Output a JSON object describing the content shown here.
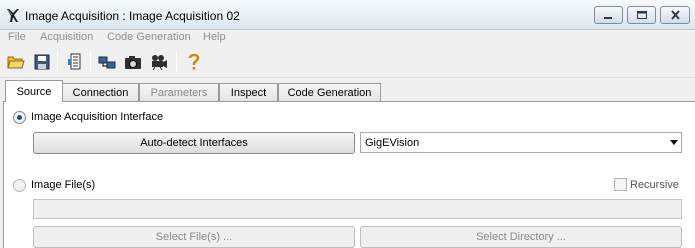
{
  "window": {
    "title": "Image Acquisition : Image Acquisition 02"
  },
  "menu": {
    "items": [
      "File",
      "Acquisition",
      "Code Generation",
      "Help"
    ]
  },
  "toolbar": {
    "buttons": [
      "open-folder-icon",
      "save-icon",
      "properties-icon",
      "connect-icon",
      "snap-icon",
      "live-icon",
      "help-icon"
    ]
  },
  "tabs": {
    "items": [
      {
        "label": "Source",
        "state": "active"
      },
      {
        "label": "Connection",
        "state": "normal"
      },
      {
        "label": "Parameters",
        "state": "disabled"
      },
      {
        "label": "Inspect",
        "state": "normal"
      },
      {
        "label": "Code Generation",
        "state": "normal"
      }
    ]
  },
  "source": {
    "interface_radio_label": "Image Acquisition Interface",
    "interface_selected": true,
    "autodetect_label": "Auto-detect Interfaces",
    "interface_value": "GigEVision",
    "files_radio_label": "Image File(s)",
    "files_selected": false,
    "recursive_label": "Recursive",
    "recursive_checked": false,
    "file_path_value": "",
    "select_files_label": "Select File(s) ...",
    "select_directory_label": "Select Directory ..."
  },
  "colors": {
    "radio_checked": "#1e4e8a",
    "titlebar_top": "#f7fafc",
    "titlebar_bottom": "#dde6ee"
  }
}
